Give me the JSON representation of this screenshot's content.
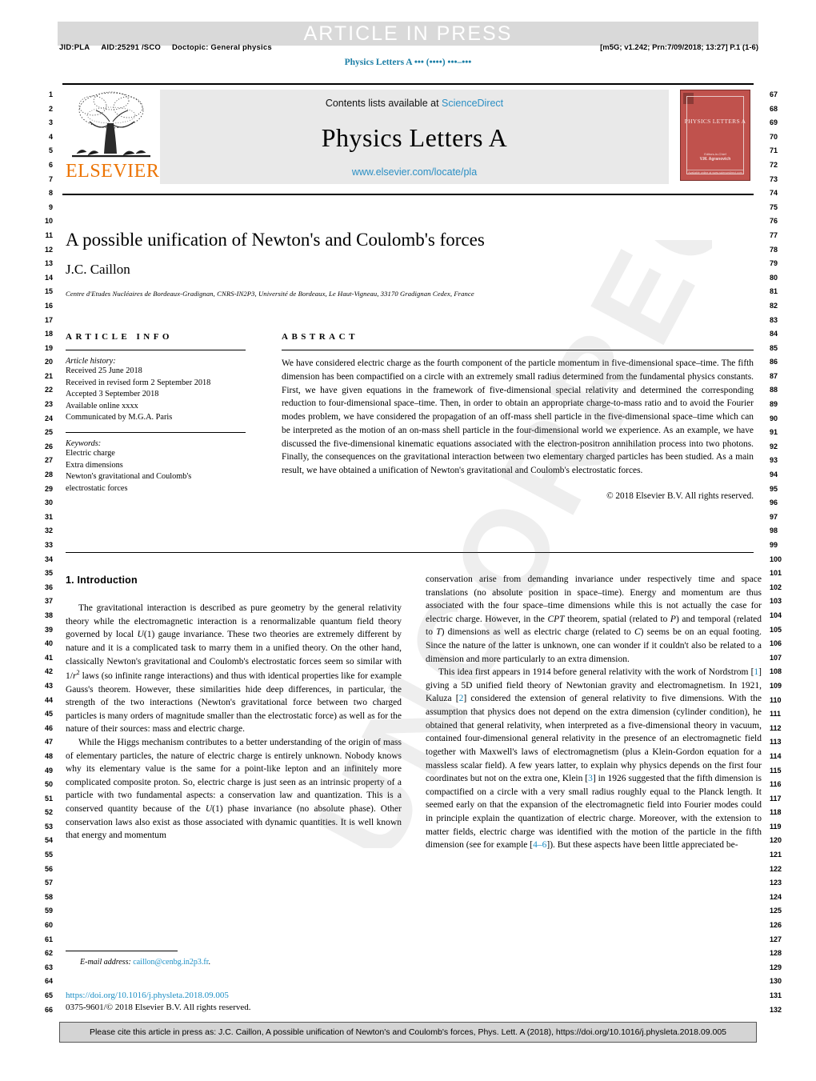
{
  "banner": {
    "article_in_press": "ARTICLE IN PRESS"
  },
  "running_head": {
    "jid": "JID:PLA",
    "aid": "AID:25291 /SCO",
    "doctopic": "Doctopic: General physics",
    "stamp": "[m5G; v1.242; Prn:7/09/2018; 13:27] P.1 (1-6)",
    "journal_ref": "Physics Letters A ••• (••••) •••–•••"
  },
  "masthead": {
    "contents_text": "Contents lists available at",
    "sciencedirect": "ScienceDirect",
    "journal_name": "Physics Letters A",
    "journal_url": "www.elsevier.com/locate/pla",
    "publisher": "ELSEVIER",
    "cover": {
      "title": "PHYSICS LETTERS A",
      "foot_small": "Editors-in-Chief",
      "foot_bold": "V.M. Agranovich",
      "base": "Available online at www.sciencedirect.com"
    }
  },
  "article": {
    "title": "A possible unification of Newton's and Coulomb's forces",
    "author": "J.C. Caillon",
    "affiliation": "Centre d'Etudes Nucléaires de Bordeaux-Gradignan, CNRS-IN2P3, Université de Bordeaux, Le Haut-Vigneau, 33170 Gradignan Cedex, France"
  },
  "info": {
    "heading": "ARTICLE INFO",
    "history_label": "Article history:",
    "history": [
      "Received 25 June 2018",
      "Received in revised form 2 September 2018",
      "Accepted 3 September 2018",
      "Available online xxxx",
      "Communicated by M.G.A. Paris"
    ],
    "keywords_label": "Keywords:",
    "keywords": [
      "Electric charge",
      "Extra dimensions",
      "Newton's gravitational and Coulomb's",
      "electrostatic forces"
    ]
  },
  "abstract": {
    "heading": "ABSTRACT",
    "text": "We have considered electric charge as the fourth component of the particle momentum in five-dimensional space–time. The fifth dimension has been compactified on a circle with an extremely small radius determined from the fundamental physics constants. First, we have given equations in the framework of five-dimensional special relativity and determined the corresponding reduction to four-dimensional space–time. Then, in order to obtain an appropriate charge-to-mass ratio and to avoid the Fourier modes problem, we have considered the propagation of an off-mass shell particle in the five-dimensional space–time which can be interpreted as the motion of an on-mass shell particle in the four-dimensional world we experience. As an example, we have discussed the five-dimensional kinematic equations associated with the electron-positron annihilation process into two photons. Finally, the consequences on the gravitational interaction between two elementary charged particles has been studied. As a main result, we have obtained a unification of Newton's gravitational and Coulomb's electrostatic forces.",
    "copyright": "© 2018 Elsevier B.V. All rights reserved."
  },
  "body": {
    "section_heading": "1. Introduction",
    "col1_p1_a": "The gravitational interaction is described as pure geometry by the general relativity theory while the electromagnetic interaction is a renormalizable quantum field theory governed by local ",
    "col1_p1_U": "U",
    "col1_p1_b": "(1) gauge invariance. These two theories are extremely different by nature and it is a complicated task to marry them in a unified theory. On the other hand, classically Newton's gravitational and Coulomb's electrostatic forces seem so similar with 1/",
    "col1_p1_r": "r",
    "col1_p1_sup": "2",
    "col1_p1_c": " laws (so infinite range interactions) and thus with identical properties like for example Gauss's theorem. However, these similarities hide deep differences, in particular, the strength of the two interactions (Newton's gravitational force between two charged particles is many orders of magnitude smaller than the electrostatic force) as well as for the nature of their sources: mass and electric charge.",
    "col1_p2_a": "While the Higgs mechanism contributes to a better understanding of the origin of mass of elementary particles, the nature of electric charge is entirely unknown. Nobody knows why its elementary value is the same for a point-like lepton and an infinitely more complicated composite proton. So, electric charge is just seen as an intrinsic property of a particle with two fundamental aspects: a conservation law and quantization. This is a conserved quantity because of the ",
    "col1_p2_U": "U",
    "col1_p2_b": "(1) phase invariance (no absolute phase). Other conservation laws also exist as those associated with dynamic quantities. It is well known that energy and momentum",
    "col2_p1_a": "conservation arise from demanding invariance under respectively time and space translations (no absolute position in space–time). Energy and momentum are thus associated with the four space–time dimensions while this is not actually the case for electric charge. However, in the ",
    "col2_p1_cpt": "CPT",
    "col2_p1_b": " theorem, spatial (related to ",
    "col2_p1_P": "P",
    "col2_p1_c": ") and temporal (related to ",
    "col2_p1_T": "T",
    "col2_p1_d": ") dimensions as well as electric charge (related to ",
    "col2_p1_C": "C",
    "col2_p1_e": ") seems be on an equal footing. Since the nature of the latter is unknown, one can wonder if it couldn't also be related to a dimension and more particularly to an extra dimension.",
    "col2_p2_a": "This idea first appears in 1914 before general relativity with the work of Nordstrom [",
    "col2_p2_ref1": "1",
    "col2_p2_b": "] giving a 5D unified field theory of Newtonian gravity and electromagnetism. In 1921, Kaluza [",
    "col2_p2_ref2": "2",
    "col2_p2_c": "] considered the extension of general relativity to five dimensions. With the assumption that physics does not depend on the extra dimension (cylinder condition), he obtained that general relativity, when interpreted as a five-dimensional theory in vacuum, contained four-dimensional general relativity in the presence of an electromagnetic field together with Maxwell's laws of electromagnetism (plus a Klein-Gordon equation for a massless scalar field). A few years latter, to explain why physics depends on the first four coordinates but not on the extra one, Klein [",
    "col2_p2_ref3": "3",
    "col2_p2_d": "] in 1926 suggested that the fifth dimension is compactified on a circle with a very small radius roughly equal to the Planck length. It seemed early on that the expansion of the electromagnetic field into Fourier modes could in principle explain the quantization of electric charge. Moreover, with the extension to matter fields, electric charge was identified with the motion of the particle in the fifth dimension (see for example [",
    "col2_p2_ref46": "4–6",
    "col2_p2_e": "]). But these aspects have been little appreciated be-"
  },
  "footnote": {
    "email_label": "E-mail address:",
    "email": "caillon@cenbg.in2p3.fr",
    "email_tail": ".",
    "doi": "https://doi.org/10.1016/j.physleta.2018.09.005",
    "issn": "0375-9601/© 2018 Elsevier B.V. All rights reserved."
  },
  "cite_box": {
    "text": "Please cite this article in press as: J.C. Caillon, A possible unification of Newton's and Coulomb's forces, Phys. Lett. A (2018), https://doi.org/10.1016/j.physleta.2018.09.005"
  },
  "gutter": {
    "left_start": 1,
    "left_end": 66,
    "right_start": 67,
    "right_end": 132
  },
  "watermark": {
    "text": "UNCORRECTED PROOF"
  },
  "colors": {
    "link": "#2b8fc4",
    "journal_ref": "#1b7ea6",
    "elsevier_orange": "#ec7404",
    "cover_red": "#c0524d",
    "banner_gray": "#d9d9d9",
    "sd_box_gray": "#e9e9e9",
    "cite_gray": "#d4d4d4"
  }
}
